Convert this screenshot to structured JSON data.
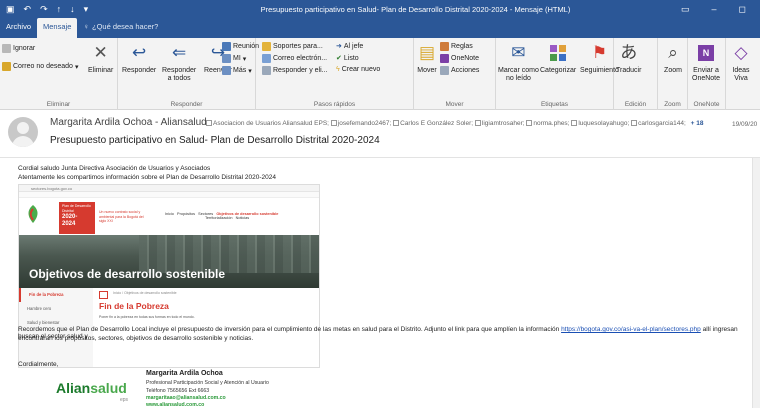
{
  "window": {
    "title": "Presupuesto participativo en Salud- Plan de Desarrollo Distrital 2020-2024  -  Mensaje (HTML)"
  },
  "tabs": {
    "archivo": "Archivo",
    "mensaje": "Mensaje",
    "tell_me": "¿Qué desea hacer?"
  },
  "ribbon": {
    "eliminar_group": {
      "ignorar": "Ignorar",
      "correo_no_deseado": "Correo no deseado",
      "eliminar": "Eliminar",
      "label": "Eliminar"
    },
    "responder_group": {
      "responder": "Responder",
      "responder_todos_1": "Responder",
      "responder_todos_2": "a todos",
      "reenviar": "Reenviar",
      "reunion": "Reunión",
      "mi": "MI",
      "mas": "Más",
      "label": "Responder"
    },
    "pasos_group": {
      "item1": "Soportes para...",
      "item2": "Correo electrón...",
      "item3": "Responder y eli...",
      "item4": "Al jefe",
      "item5": "Listo",
      "item6": "Crear nuevo",
      "label": "Pasos rápidos"
    },
    "mover_group": {
      "mover": "Mover",
      "reglas": "Reglas",
      "onenote": "OneNote",
      "acciones": "Acciones",
      "label": "Mover"
    },
    "etiquetas_group": {
      "marcar_1": "Marcar como",
      "marcar_2": "no leído",
      "categorizar": "Categorizar",
      "seguimiento": "Seguimiento",
      "label": "Etiquetas"
    },
    "edicion_group": {
      "traducir": "Traducir",
      "label": "Edición"
    },
    "zoom_group": {
      "zoom": "Zoom",
      "label": "Zoom"
    },
    "onenote_group": {
      "enviar_1": "Enviar a",
      "enviar_2": "OneNote",
      "label": "OneNote"
    },
    "ideas_group": {
      "ideas_1": "Ideas",
      "ideas_2": "Viva"
    }
  },
  "header": {
    "sender": "Margarita Ardila Ochoa - Aliansalud",
    "recipients": [
      "Asociacion de Usuarios Aliansalud EPS;",
      "josefemando2467;",
      "Carlos E González Soler;",
      "ligiamtrosaher;",
      "norma.phes;",
      "luquesolayahugo;",
      "carlosgarcia144;"
    ],
    "extra_count": "18",
    "date": "19/09/20",
    "subject": "Presupuesto participativo en Salud- Plan de Desarrollo Distrital 2020-2024"
  },
  "body": {
    "greeting": "Cordial saludo Junta Directiva Asociación de Usuarios y Asociados",
    "intro": "Atentamente  les compartimos información sobre el Plan de Desarrollo Distrital 2020-2024",
    "paragraph_a": "Recordemos que el Plan de Desarrollo Local incluye el presupuesto de inversión para el cumplimiento de las metas en salud para el Distrito. Adjunto el link para que amplíen la información ",
    "link": "https://bogota.gov.co/asi-va-el-plan/sectores.php",
    "paragraph_b": " allí ingresan buscan el sector salud y",
    "paragraph_c": "encontraran los propositos, sectores, objetivos de desarrollo sostenible y noticias.",
    "closing": "Cordialmente,"
  },
  "embedded_site": {
    "url": "sectores.bogota.gov.co",
    "plan_line1": "Plan de Desarrollo",
    "plan_line2": "Distrital",
    "plan_years_1": "2020-",
    "plan_years_2": "2024",
    "plan_tagline": "Un nuevo contrato social y ambiental para la Bogotá del siglo XXI",
    "nav_inicio": "Inicio",
    "nav_propositos": "Propósitos",
    "nav_sectores": "Sectores",
    "nav_objetivos": "Objetivos de desarrollo sostenible",
    "nav_territorializacion": "Territorialización",
    "nav_noticias": "Noticias",
    "hero_title": "Objetivos de desarrollo sostenible",
    "side_items": [
      "Fin de la Pobreza",
      "Hambre cero",
      "Salud y bienestar"
    ],
    "breadcrumb": "Inicio / Objetivos de desarrollo sostenible",
    "heading": "Fin de la Pobreza",
    "description": "Poner fin a la pobreza en todas sus formas en todo el mundo."
  },
  "signature": {
    "logo_text_a": "Alian",
    "logo_text_b": "salud",
    "logo_sub": "eps",
    "name": "Margarita Ardila Ochoa",
    "role": "Profesional Participación Social y Atención al Usuario",
    "phone": "Teléfono 7565656 Ext 6663",
    "email": "margaritaao@aliansalud.com.co",
    "web": "www.aliansalud.com.co"
  },
  "colors": {
    "accent": "#2b5797",
    "brand_red": "#d63a2f",
    "brand_green": "#49a84c"
  }
}
